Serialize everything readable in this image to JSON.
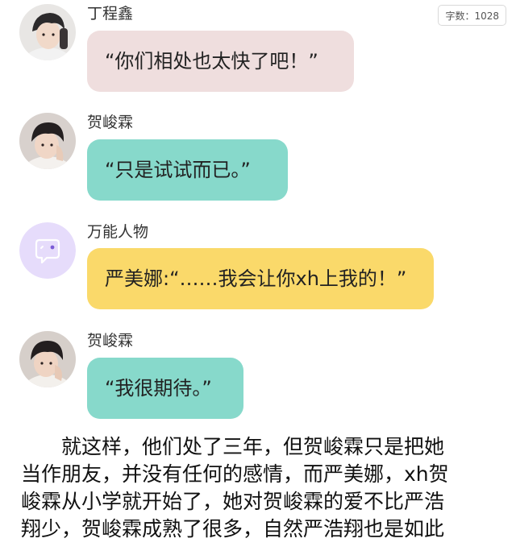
{
  "word_count": "字数：1028",
  "messages": [
    {
      "speaker": "丁程鑫",
      "text": "“你们相处也太快了吧！”",
      "avatar": "person-avatar",
      "bubble_color": "#efdede"
    },
    {
      "speaker": "贺峻霖",
      "text": "“只是试试而已。”",
      "avatar": "person-avatar",
      "bubble_color": "#87d9cb"
    },
    {
      "speaker": "万能人物",
      "text": "严美娜:“……我会让你xh上我的！”",
      "avatar": "chat-bubble-icon",
      "bubble_color": "#fad96a"
    },
    {
      "speaker": "贺峻霖",
      "text": "“我很期待。”",
      "avatar": "person-avatar",
      "bubble_color": "#87d9cb"
    }
  ],
  "paragraph": {
    "lines": [
      "　　就这样，他们处了三年，但贺峻霖只是把她",
      "当作朋友，并没有任何的感情，而严美娜，xh贺",
      "峻霖从小学就开始了，她对贺峻霖的爱不比严浩",
      "翔少，贺峻霖成熟了很多，自然严浩翔也是如此"
    ]
  }
}
